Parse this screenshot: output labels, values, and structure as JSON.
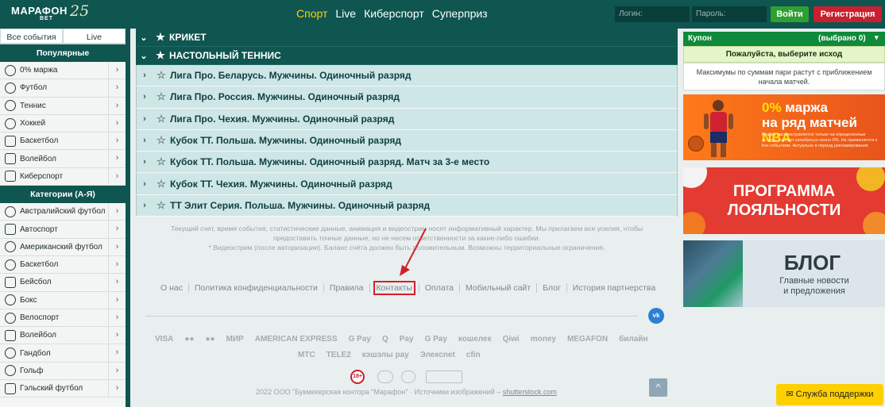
{
  "header": {
    "logo_main": "МАРАФОН",
    "logo_sub": "BET",
    "logo_25": "25",
    "nav": [
      "Спорт",
      "Live",
      "Киберспорт",
      "Суперприз"
    ],
    "login_placeholder": "Логин:",
    "password_placeholder": "Пароль:",
    "login_button": "Войти",
    "register_button": "Регистрация"
  },
  "sidebar": {
    "tab_all": "Все события",
    "tab_live": "Live",
    "popular_title": "Популярные",
    "popular": [
      "0% маржа",
      "Футбол",
      "Теннис",
      "Хоккей",
      "Баскетбол",
      "Волейбол",
      "Киберспорт"
    ],
    "categories_title": "Категории (А-Я)",
    "categories": [
      "Австралийский футбол",
      "Автоспорт",
      "Американский футбол",
      "Баскетбол",
      "Бейсбол",
      "Бокс",
      "Велоспорт",
      "Волейбол",
      "Гандбол",
      "Гольф",
      "Гэльский футбол"
    ]
  },
  "main": {
    "sport_categories": [
      "КРИКЕТ",
      "НАСТОЛЬНЫЙ ТЕННИС"
    ],
    "leagues": [
      "Лига Про. Беларусь. Мужчины. Одиночный разряд",
      "Лига Про. Россия. Мужчины. Одиночный разряд",
      "Лига Про. Чехия. Мужчины. Одиночный разряд",
      "Кубок ТТ. Польша. Мужчины. Одиночный разряд",
      "Кубок ТТ. Польша. Мужчины. Одиночный разряд. Матч за 3-е место",
      "Кубок ТТ. Чехия. Мужчины. Одиночный разряд",
      "ТТ Элит Серия. Польша. Мужчины. Одиночный разряд"
    ]
  },
  "footer": {
    "disclaimer_1": "Текущий счет, время события, статистические данные, анимация и видеострим носят информативный характер. Мы прилагаем все усилия, чтобы",
    "disclaimer_2": "предоставить точные данные, но не несем ответственности за какие-либо ошибки.",
    "disclaimer_3": "* Видеострим (после авторизации). Баланс счёта должен быть положительным. Возможны территориальные ограничения.",
    "links": [
      "О нас",
      "Политика конфиденциальности",
      "Правила",
      "Контакты",
      "Оплата",
      "Мобильный сайт",
      "Блог",
      "История партнерства"
    ],
    "vk": "vk",
    "payments_row1": [
      "VISA",
      "●●",
      "●●",
      "МИР",
      "AMERICAN EXPRESS",
      "G Pay",
      "Q",
      "Pay",
      "G Pay",
      "кошелек",
      "Qiwi",
      "money",
      "MEGAFON",
      "билайн"
    ],
    "payments_row2": [
      "МТС",
      "TELE2",
      "кэшэлы pay",
      "Элексnet",
      "cfin"
    ],
    "age_badge": "18+",
    "copyright_text": "2022 ООО \"Букмекерская контора \"Марафон\" · Источники изображений – ",
    "copyright_link": "shutterstock.com",
    "scroll_top": "^"
  },
  "coupon": {
    "title": "Купон",
    "selected": "(выбрано 0)",
    "note": "Пожалуйста, выберите исход",
    "info": "Максимумы по суммам пари растут с приближением начала матчей."
  },
  "banners": {
    "nba_line1": "0%",
    "nba_line1_rest": " маржа",
    "nba_line2": "на ряд матчей ",
    "nba_tag": "NBA",
    "nba_small": "Маржа распространяется только на определенные исходы и может колебаться около 0%. Не применяется к live-событиям. Актуально в период рекламирования",
    "loyalty_line1": "ПРОГРАММА",
    "loyalty_line2": "ЛОЯЛЬНОСТИ",
    "blog_title": "БЛОГ",
    "blog_sub_1": "Главные новости",
    "blog_sub_2": "и предложения"
  },
  "support": "Служба поддержки",
  "colors": {
    "brand": "#0f5550",
    "active_nav": "#ffd400",
    "login": "#2f9f32",
    "register": "#c8202f",
    "coupon": "#0f8a3a"
  }
}
